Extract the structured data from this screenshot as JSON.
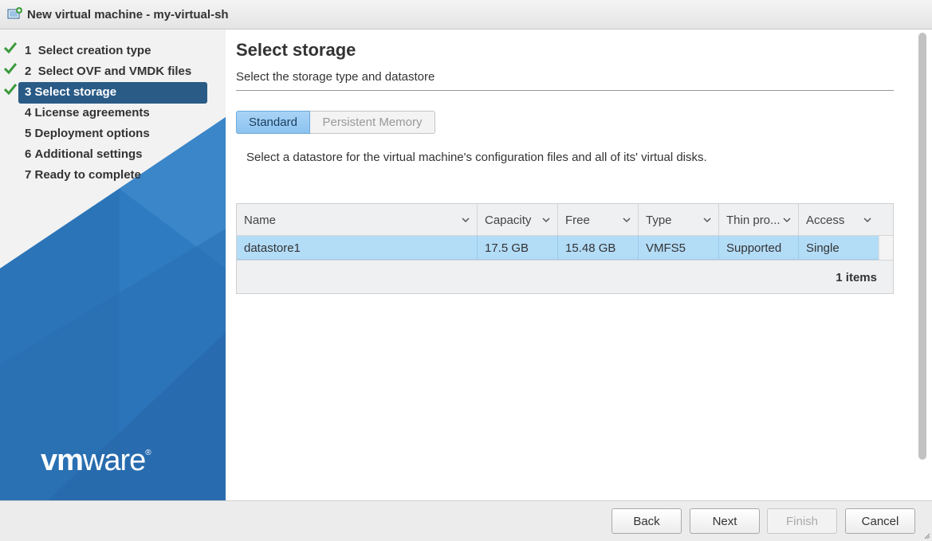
{
  "window": {
    "title": "New virtual machine - my-virtual-sh"
  },
  "steps": [
    {
      "num": "1",
      "label": "Select creation type",
      "done": true
    },
    {
      "num": "2",
      "label": "Select OVF and VMDK files",
      "done": true
    },
    {
      "num": "3",
      "label": "Select storage",
      "done": true,
      "active": true
    },
    {
      "num": "4",
      "label": "License agreements",
      "done": false
    },
    {
      "num": "5",
      "label": "Deployment options",
      "done": false
    },
    {
      "num": "6",
      "label": "Additional settings",
      "done": false
    },
    {
      "num": "7",
      "label": "Ready to complete",
      "done": false
    }
  ],
  "brand": {
    "logo_vm": "vm",
    "logo_ware": "ware",
    "mark": "®"
  },
  "page": {
    "title": "Select storage",
    "subtitle": "Select the storage type and datastore",
    "instruction": "Select a datastore for the virtual machine's configuration files and all of its' virtual disks."
  },
  "tabs": {
    "standard": "Standard",
    "persistent": "Persistent Memory"
  },
  "table": {
    "columns": [
      "Name",
      "Capacity",
      "Free",
      "Type",
      "Thin pro...",
      "Access"
    ],
    "rows": [
      [
        "datastore1",
        "17.5 GB",
        "15.48 GB",
        "VMFS5",
        "Supported",
        "Single"
      ]
    ],
    "footer": "1 items"
  },
  "buttons": {
    "back": "Back",
    "next": "Next",
    "finish": "Finish",
    "cancel": "Cancel"
  },
  "colors": {
    "accent": "#2a5b86",
    "check": "#3c9a3c",
    "selected_row": "#b3dcf7",
    "tab_active": "#a9d3f6"
  }
}
